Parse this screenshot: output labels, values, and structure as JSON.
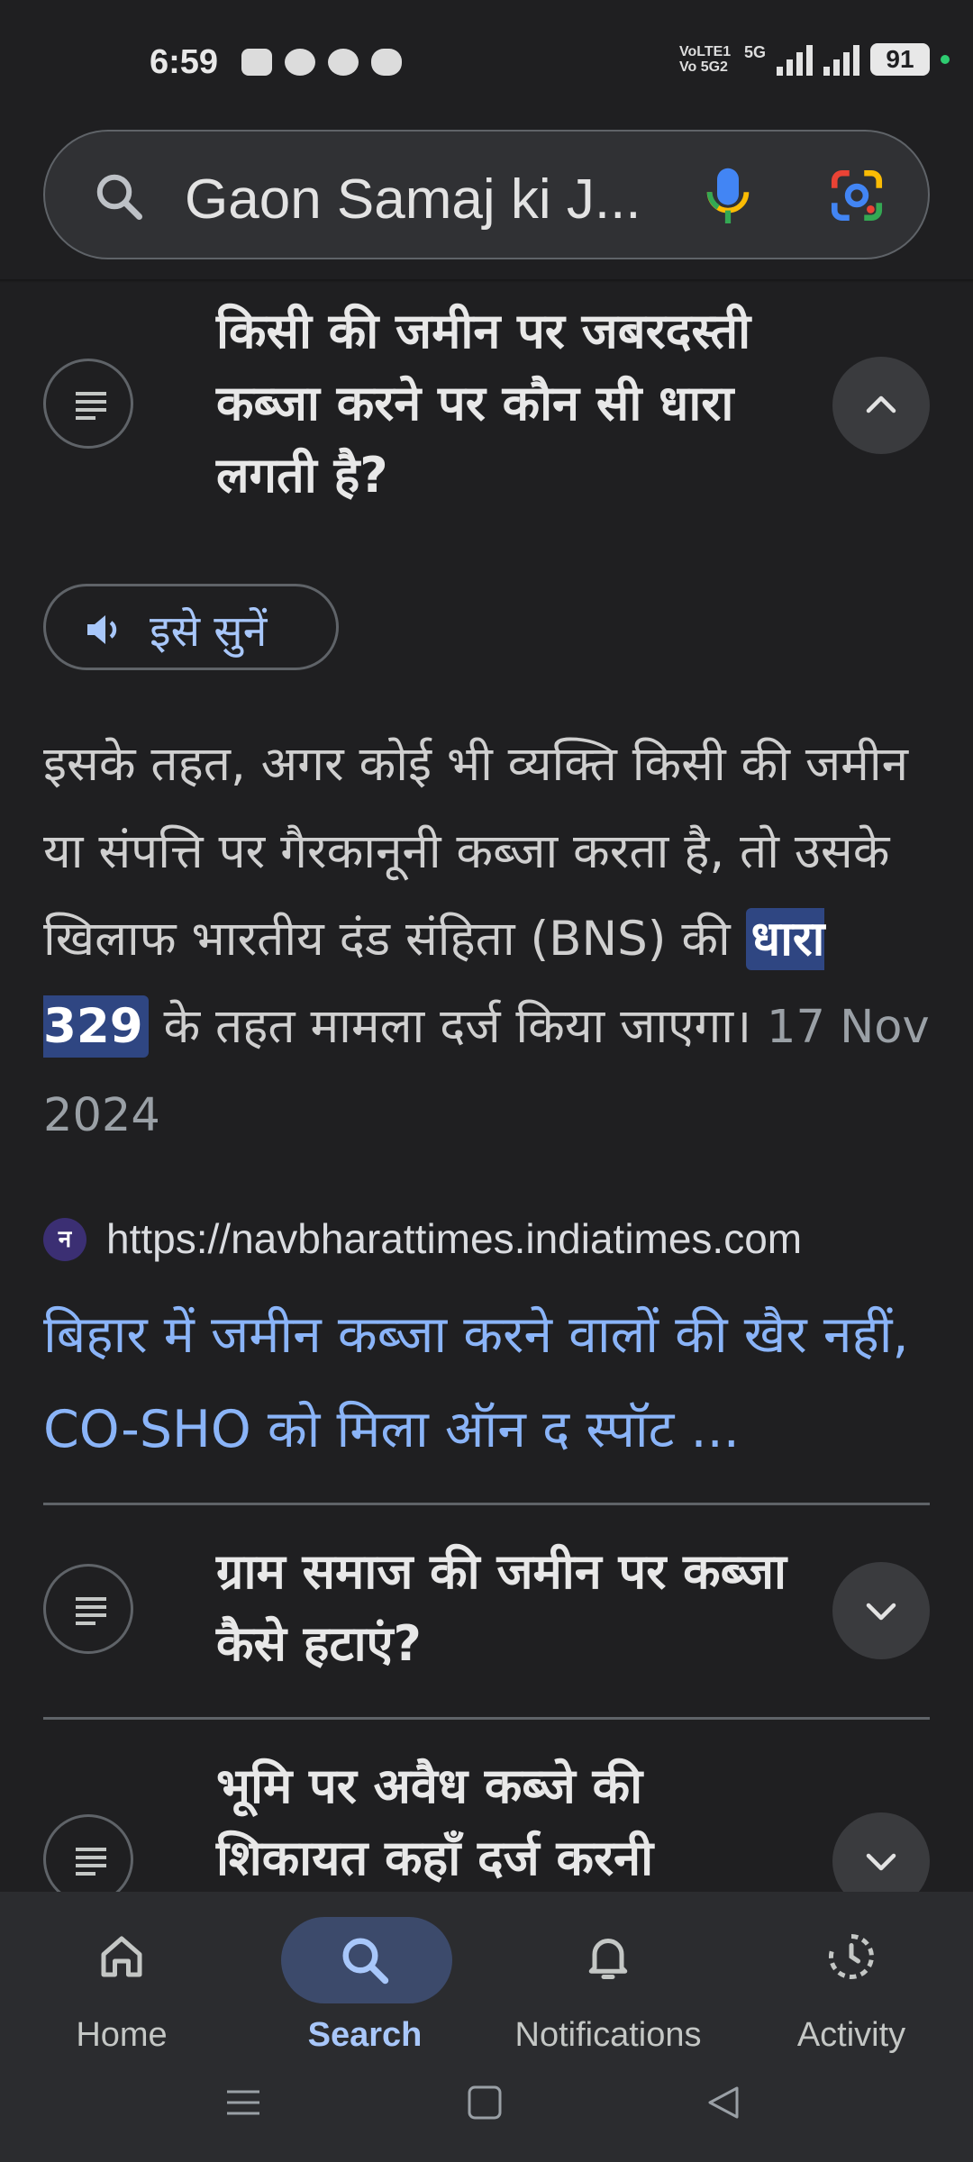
{
  "status_bar": {
    "time": "6:59",
    "network_label": "VoLTE1 Vo 5G2",
    "network_type": "5G",
    "battery": "91"
  },
  "search": {
    "query": "Gaon Samaj ki J..."
  },
  "faq": [
    {
      "question": "किसी की जमीन पर जबरदस्ती कब्जा करने पर कौन सी धारा लगती है?",
      "expanded": true
    },
    {
      "question": "ग्राम समाज की जमीन पर कब्जा कैसे हटाएं?",
      "expanded": false
    },
    {
      "question": "भूमि पर अवैध कब्जे की शिकायत कहाँ दर्ज करनी",
      "expanded": false
    }
  ],
  "answer": {
    "listen_label": "इसे सुनें",
    "text_before": "इसके तहत, अगर कोई भी व्यक्ति किसी की जमीन या संपत्ति पर गैरकानूनी कब्जा करता है, तो उसके खिलाफ भारतीय दंड संहिता (BNS) की ",
    "highlight": "धारा 329",
    "text_after": " के तहत मामला दर्ज किया जाएगा। ",
    "date": "17 Nov 2024",
    "source_icon_letter": "न",
    "source_url": "https://navbharattimes.indiatimes.com",
    "source_title": "बिहार में जमीन कब्जा करने वालों की खैर नहीं, CO-SHO को मिला ऑन द स्पॉट ..."
  },
  "bottom_nav": {
    "home": "Home",
    "search": "Search",
    "notifications": "Notifications",
    "activity": "Activity",
    "active": "search"
  },
  "colors": {
    "background": "#1f1f21",
    "link": "#8ab4f8",
    "highlight": "#2f4682",
    "nav_active": "#a8c7fa"
  }
}
